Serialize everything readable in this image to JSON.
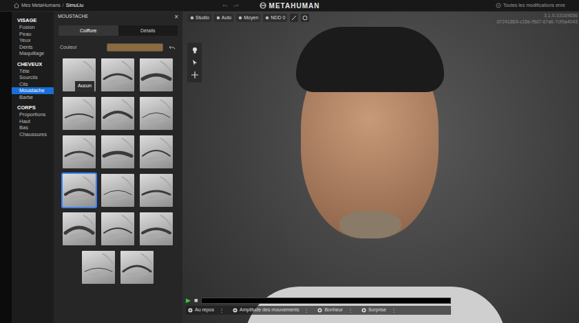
{
  "breadcrumb": {
    "items": [
      "Mes MetaHumans",
      "SimuLiu"
    ],
    "separator": "/"
  },
  "logo": "METAHUMAN",
  "save_status": "Toutes les modifications enre",
  "version": [
    "3.1.0-33169656",
    "d7241869-c15e-f5d7-67a6-7cf0a4043"
  ],
  "sidebar": {
    "sections": [
      {
        "title": "VISAGE",
        "items": [
          {
            "label": "Fusion",
            "selected": false
          },
          {
            "label": "Peau",
            "selected": false
          },
          {
            "label": "Yeux",
            "selected": false
          },
          {
            "label": "Dents",
            "selected": false
          },
          {
            "label": "Maquillage",
            "selected": false
          }
        ]
      },
      {
        "title": "CHEVEUX",
        "items": [
          {
            "label": "Tête",
            "selected": false
          },
          {
            "label": "Sourcils",
            "selected": false
          },
          {
            "label": "Cils",
            "selected": false
          },
          {
            "label": "Moustache",
            "selected": true
          },
          {
            "label": "Barbe",
            "selected": false
          }
        ]
      },
      {
        "title": "CORPS",
        "items": [
          {
            "label": "Proportions",
            "selected": false
          },
          {
            "label": "Haut",
            "selected": false
          },
          {
            "label": "Bas",
            "selected": false
          },
          {
            "label": "Chaussures",
            "selected": false
          }
        ]
      }
    ]
  },
  "panel": {
    "title": "MOUSTACHE",
    "close": "×",
    "tabs": [
      {
        "label": "Coiffure",
        "selected": true
      },
      {
        "label": "Détails",
        "selected": false
      }
    ],
    "color": {
      "label": "Couleur",
      "swatch": "#8b6b3e"
    },
    "tooltip": "Aucun",
    "thumbnails": [
      {
        "selected": false
      },
      {
        "selected": false
      },
      {
        "selected": false
      },
      {
        "selected": false
      },
      {
        "selected": false
      },
      {
        "selected": false
      },
      {
        "selected": false
      },
      {
        "selected": false
      },
      {
        "selected": false
      },
      {
        "selected": true
      },
      {
        "selected": false
      },
      {
        "selected": false
      },
      {
        "selected": false
      },
      {
        "selected": false
      },
      {
        "selected": false
      },
      {
        "selected": false
      },
      {
        "selected": false
      }
    ]
  },
  "viewport": {
    "toolbar": [
      "Studio",
      "Auto",
      "Moyen",
      "NDD 0"
    ],
    "playback": {
      "play": "▶",
      "stop": "■",
      "level": 0
    },
    "animation_menu": "⋮",
    "animations": [
      "Au repos",
      "Amplitude des mouvements",
      "Bonheur",
      "Surprise"
    ]
  }
}
